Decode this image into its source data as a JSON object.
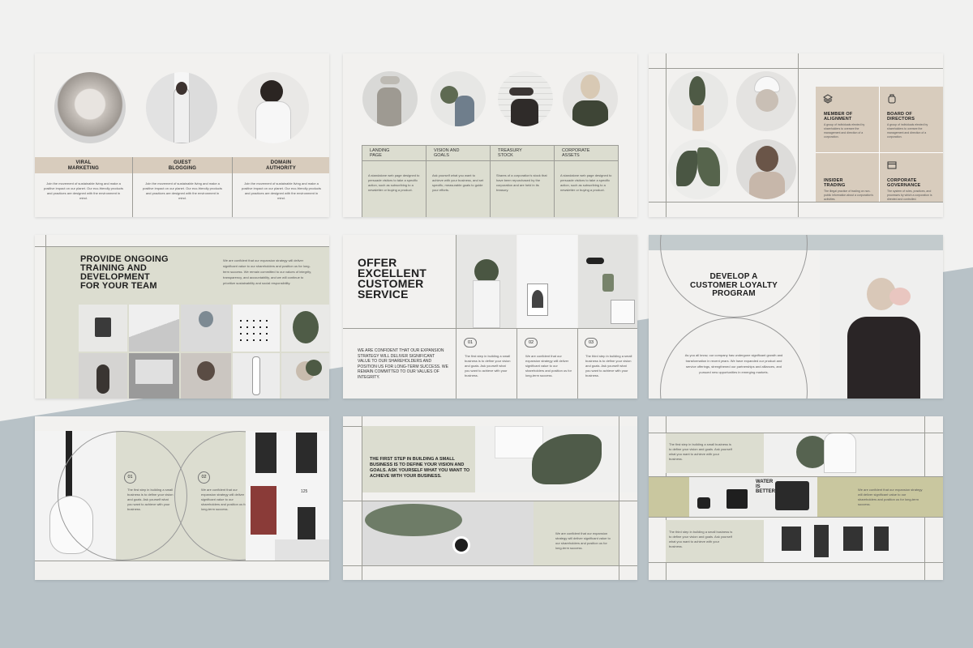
{
  "colors": {
    "sage": "#dcddd0",
    "beige": "#d8ccbd",
    "olive": "#c9c79f",
    "steel": "#b7c1c6",
    "bg": "#f1f1f0"
  },
  "s1": {
    "cols": [
      {
        "title": "VIRAL\nMARKETING",
        "body": "Join the movement of sustainable living and make a positive impact on our planet. Our eco-friendly products and practices are designed with the environment in mind."
      },
      {
        "title": "GUEST\nBLOGGING",
        "body": "Join the movement of sustainable living and make a positive impact on our planet. Our eco-friendly products and practices are designed with the environment in mind."
      },
      {
        "title": "DOMAIN\nAUTHORITY",
        "body": "Join the movement of sustainable living and make a positive impact on our planet. Our eco-friendly products and practices are designed with the environment in mind."
      }
    ]
  },
  "s2": {
    "cols": [
      {
        "title": "LANDING\nPAGE",
        "body": "A standalone web page designed to persuade visitors to take a specific action, such as subscribing to a newsletter or buying a product."
      },
      {
        "title": "VISION AND\nGOALS",
        "body": "Ask yourself what you want to achieve with your business, and set specific, measurable goals to guide your efforts."
      },
      {
        "title": "TREASURY\nSTOCK",
        "body": "Shares of a corporation's stock that have been repurchased by the corporation and are held in its treasury."
      },
      {
        "title": "CORPORATE\nASSETS",
        "body": "A standalone web page designed to persuade visitors to take a specific action, such as subscribing to a newsletter or buying a product."
      }
    ]
  },
  "s3": {
    "cells": [
      {
        "icon": "layers-icon",
        "title": "MEMBER OF\nALIGNMENT",
        "body": "A group of individuals elected by shareholders to oversee the management and direction of a corporation."
      },
      {
        "icon": "jar-icon",
        "title": "BOARD OF\nDIRECTORS",
        "body": "A group of individuals elected by shareholders to oversee the management and direction of a corporation."
      },
      {
        "icon": "",
        "title": "INSIDER\nTRADING",
        "body": "The illegal practice of trading on non-public information about a corporation's activities."
      },
      {
        "icon": "browser-icon",
        "title": "CORPORATE\nGOVERNANCE",
        "body": "The system of rules, practices, and processes by which a corporation is directed and controlled."
      }
    ]
  },
  "s4": {
    "title": "PROVIDE ONGOING\nTRAINING AND\nDEVELOPMENT\nFOR YOUR TEAM",
    "body": "We are confident that our expansion strategy will deliver significant value to our shareholders and position us for long-term success. We remain committed to our values of integrity, transparency, and accountability, and we will continue to prioritize sustainability and social responsibility."
  },
  "s5": {
    "title": "OFFER\nEXCELLENT\nCUSTOMER\nSERVICE",
    "body": "WE ARE CONFIDENT THAT OUR EXPANSION STRATEGY WILL DELIVER SIGNIFICANT VALUE TO OUR SHAREHOLDERS AND POSITION US FOR LONG-TERM SUCCESS. WE REMAIN COMMITTED TO OUR VALUES OF INTEGRITY.",
    "steps": [
      {
        "num": "01",
        "text": "The first step in building a small business is to define your vision and goals. Ask yourself what you want to achieve with your business."
      },
      {
        "num": "02",
        "text": "We are confident that our expansion strategy will deliver significant value to our shareholders and position us for long-term success."
      },
      {
        "num": "03",
        "text": "The third step in building a small business is to define your vision and goals. Ask yourself what you want to achieve with your business."
      }
    ]
  },
  "s6": {
    "title": "DEVELOP A\nCUSTOMER LOYALTY\nPROGRAM",
    "body": "As you all know, our company has undergone significant growth and transformation in recent years. We have expanded our product and service offerings, strengthened our partnerships and alliances, and pursued new opportunities in emerging markets."
  },
  "s7": {
    "steps": [
      {
        "num": "01",
        "text": "The first step in building a small business is to define your vision and goals. Ask yourself what you want to achieve with your business."
      },
      {
        "num": "02",
        "text": "We are confident that our expansion strategy will deliver significant value to our shareholders and position us for long-term success."
      }
    ],
    "door_number": "125"
  },
  "s8": {
    "title": "THE FIRST STEP IN BUILDING A SMALL BUSINESS IS TO DEFINE YOUR VISION AND GOALS. ASK YOURSELF WHAT YOU WANT TO ACHIEVE WITH YOUR BUSINESS.",
    "body": "We are confident that our expansion strategy will deliver significant value to our shareholders and position us for long-term success."
  },
  "s9": {
    "rows": [
      "The first step in building a small business is to define your vision and goals. Ask yourself what you want to achieve with your business.",
      "We are confident that our expansion strategy will deliver significant value to our shareholders and position us for long-term success.",
      "The third step in building a small business is to define your vision and goals. Ask yourself what you want to achieve with your business."
    ],
    "poster": "WATER\nIS\nBETTER"
  }
}
